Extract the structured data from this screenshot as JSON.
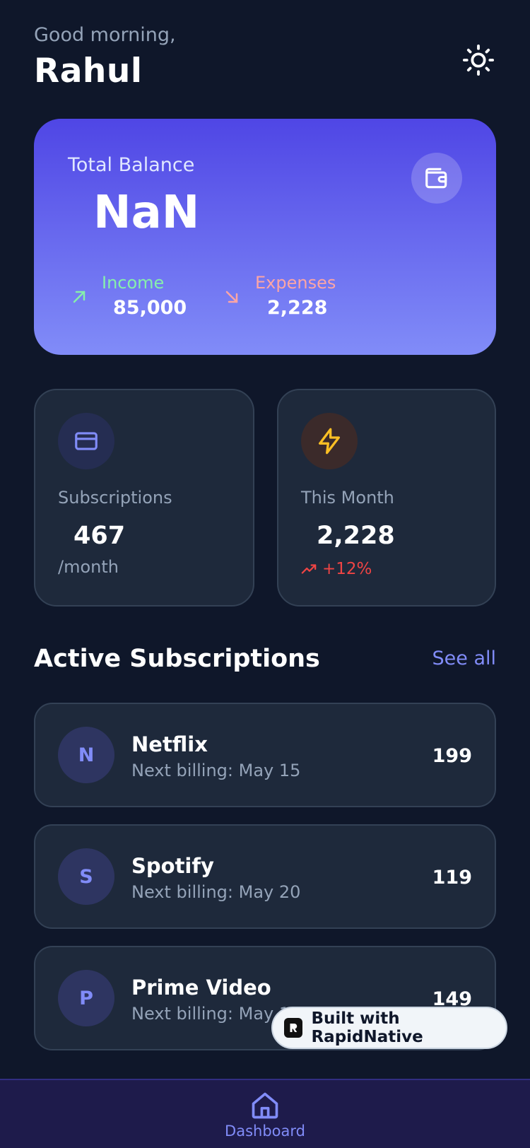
{
  "header": {
    "greeting": "Good morning,",
    "username": "Rahul"
  },
  "balance": {
    "label": "Total Balance",
    "value": "NaN",
    "income_label": "Income",
    "income_value": "85,000",
    "expenses_label": "Expenses",
    "expenses_value": "2,228"
  },
  "stats": {
    "subscriptions": {
      "label": "Subscriptions",
      "value": "467",
      "sub": "/month"
    },
    "this_month": {
      "label": "This Month",
      "value": "2,228",
      "trend": "+12%"
    }
  },
  "section": {
    "title": "Active Subscriptions",
    "see_all": "See all"
  },
  "subscriptions": [
    {
      "initial": "N",
      "name": "Netflix",
      "next": "Next billing: May 15",
      "price": "199"
    },
    {
      "initial": "S",
      "name": "Spotify",
      "next": "Next billing: May 20",
      "price": "119"
    },
    {
      "initial": "P",
      "name": "Prime Video",
      "next": "Next billing: May 18",
      "price": "149"
    }
  ],
  "badge": {
    "label": "Built with RapidNative"
  },
  "nav": {
    "dashboard": "Dashboard"
  },
  "colors": {
    "background": "#0f172a",
    "card": "#1e293b",
    "accent": "#818cf8",
    "income": "#86efac",
    "expense": "#fca5a5",
    "trend_up": "#ef4444"
  },
  "icons": [
    "sun-icon",
    "wallet-icon",
    "arrow-up-right-icon",
    "arrow-down-right-icon",
    "credit-card-icon",
    "lightning-icon",
    "trending-up-icon",
    "home-icon"
  ]
}
